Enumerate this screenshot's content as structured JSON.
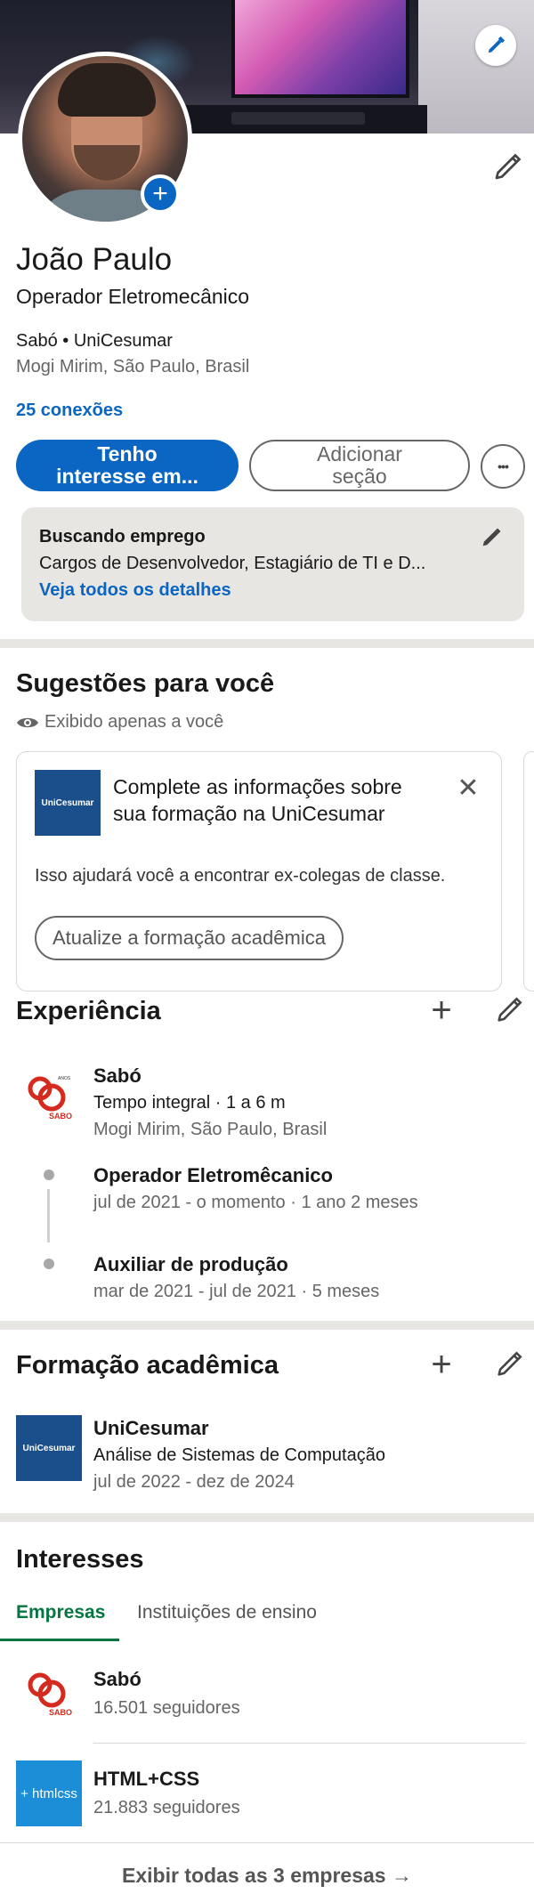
{
  "profile": {
    "name": "João Paulo",
    "headline": "Operador Eletromecânico",
    "company_line": "Sabó • UniCesumar",
    "location": "Mogi Mirim, São Paulo, Brasil",
    "connections": "25 conexões"
  },
  "actions": {
    "open_to": "Tenho interesse em...",
    "add_section": "Adicionar seção",
    "more": "•••"
  },
  "job_seeking": {
    "title": "Buscando emprego",
    "description": "Cargos de Desenvolvedor, Estagiário de TI e D...",
    "link": "Veja todos os detalhes"
  },
  "suggestions": {
    "title": "Sugestões para você",
    "visibility": "Exibido apenas a você",
    "card": {
      "logo_text": "UniCesumar",
      "text": "Complete as informações sobre sua formação na UniCesumar",
      "description": "Isso ajudará você a encontrar ex-colegas de classe.",
      "cta": "Atualize a formação acadêmica",
      "close": "✕"
    }
  },
  "experience": {
    "title": "Experiência",
    "company": {
      "name": "Sabó",
      "type": "Tempo integral · 1 a 6 m",
      "location": "Mogi Mirim, São Paulo, Brasil",
      "logo_text": "SABO",
      "logo_badge": "ANOS"
    },
    "roles": [
      {
        "title": "Operador Eletromêcanico",
        "period": "jul de 2021 - o momento · 1 ano 2 meses"
      },
      {
        "title": "Auxiliar de produção",
        "period": "mar de 2021 - jul de 2021 · 5 meses"
      }
    ]
  },
  "education": {
    "title": "Formação acadêmica",
    "school": "UniCesumar",
    "course": "Análise de Sistemas de Computação",
    "period": "jul de 2022 - dez de 2024",
    "logo_text": "UniCesumar"
  },
  "interests": {
    "title": "Interesses",
    "tabs": [
      "Empresas",
      "Instituições de ensino"
    ],
    "items": [
      {
        "name": "Sabó",
        "followers": "16.501 seguidores",
        "logo_text": "SABO"
      },
      {
        "name": "HTML+CSS",
        "followers": "21.883 seguidores",
        "logo_text": "+ htmlcss"
      }
    ],
    "show_all": "Exibir todas as 3 empresas →"
  },
  "colors": {
    "primary": "#0a66c2",
    "text": "#191919",
    "muted": "#666666",
    "divider": "#e8e6e2",
    "tab_active": "#057642",
    "sabo_red": "#d52b1e"
  }
}
